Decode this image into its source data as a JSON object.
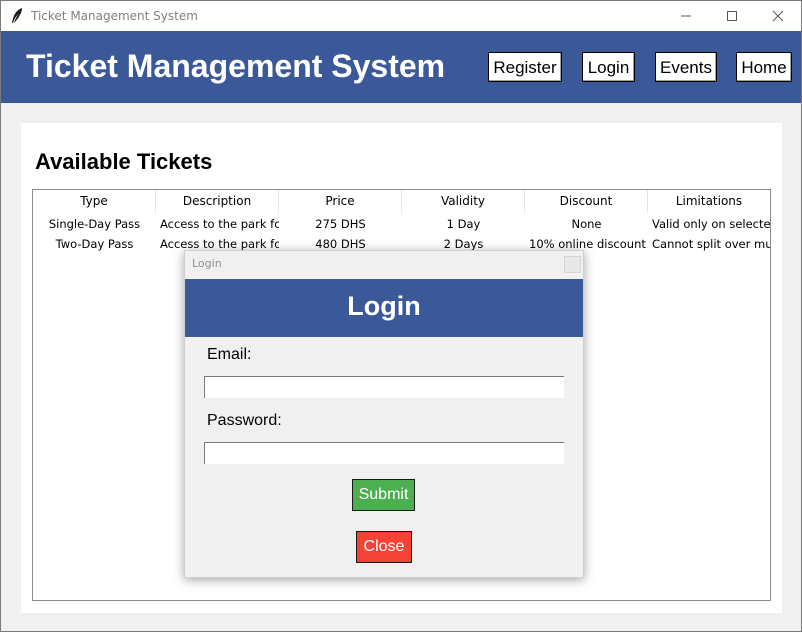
{
  "window": {
    "title": "Ticket Management System"
  },
  "header": {
    "title": "Ticket Management System",
    "nav": [
      "Register",
      "Login",
      "Events",
      "Home"
    ]
  },
  "main": {
    "section_title": "Available Tickets",
    "table": {
      "columns": [
        "Type",
        "Description",
        "Price",
        "Validity",
        "Discount",
        "Limitations"
      ],
      "rows": [
        [
          "Single-Day Pass",
          "Access to the park for",
          "275 DHS",
          "1 Day",
          "None",
          "Valid only on selected"
        ],
        [
          "Two-Day Pass",
          "Access to the park for",
          "480 DHS",
          "2 Days",
          "10% online discount",
          "Cannot split over mul"
        ]
      ]
    }
  },
  "dialog": {
    "window_title": "Login",
    "heading": "Login",
    "email_label": "Email:",
    "email_value": "",
    "password_label": "Password:",
    "password_value": "",
    "submit_label": "Submit",
    "close_label": "Close"
  },
  "colors": {
    "brand": "#3b5998",
    "submit": "#4caf50",
    "close": "#f44336"
  }
}
